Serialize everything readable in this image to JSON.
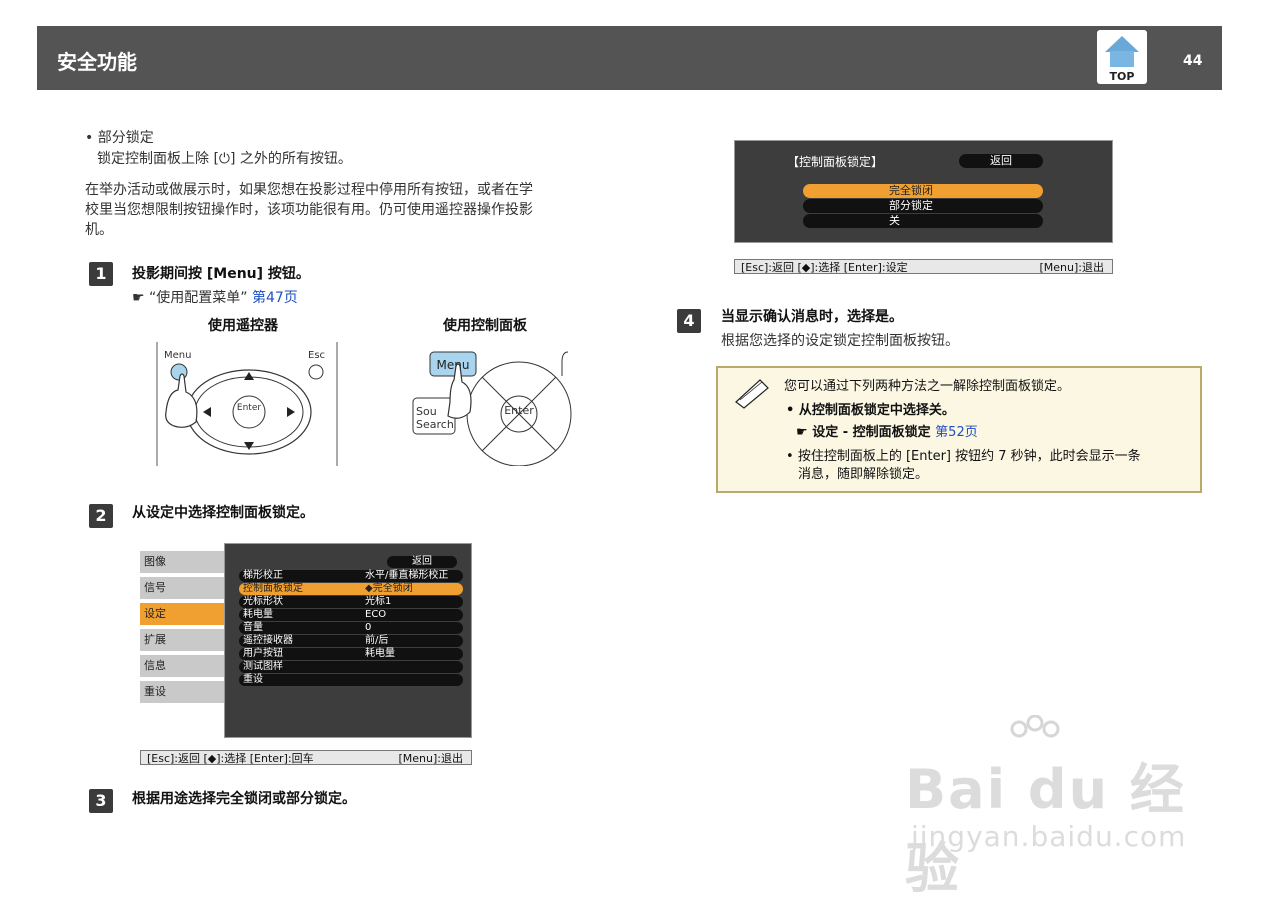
{
  "header": {
    "title": "安全功能",
    "top_label": "TOP",
    "page_number": "44"
  },
  "intro": {
    "bullet_title": "部分锁定",
    "bullet_desc": "锁定控制面板上除 [⏻] 之外的所有按钮。",
    "para_line1": "在举办活动或做展示时，如果您想在投影过程中停用所有按钮，或者在学",
    "para_line2": "校里当您想限制按钮操作时，该项功能很有用。仍可使用遥控器操作投影",
    "para_line3": "机。"
  },
  "steps": [
    {
      "num": "1",
      "text": "投影期间按 [Menu] 按钮。",
      "ref_text": "“使用配置菜单”",
      "ref_link": "第47页"
    },
    {
      "num": "2",
      "text": "从设定中选择控制面板锁定。"
    },
    {
      "num": "3",
      "text": "根据用途选择完全锁闭或部分锁定。"
    },
    {
      "num": "4",
      "text": "当显示确认消息时，选择是。",
      "desc": "根据您选择的设定锁定控制面板按钮。"
    }
  ],
  "illustrations": {
    "remote_caption": "使用遥控器",
    "panel_caption": "使用控制面板",
    "remote_menu": "Menu",
    "remote_esc": "Esc",
    "remote_enter": "Enter",
    "panel_menu": "Menu",
    "panel_source": "Sou",
    "panel_search": "Search",
    "panel_enter": "Enter"
  },
  "menu1": {
    "tabs": [
      "图像",
      "信号",
      "设定",
      "扩展",
      "信息",
      "重设"
    ],
    "back": "返回",
    "rows": [
      {
        "label": "梯形校正",
        "value": "水平/垂直梯形校正"
      },
      {
        "label": "控制面板锁定",
        "value": "◆完全锁闭"
      },
      {
        "label": "光标形状",
        "value": "光标1"
      },
      {
        "label": "耗电量",
        "value": "ECO"
      },
      {
        "label": "音量",
        "value": "0"
      },
      {
        "label": "遥控接收器",
        "value": "前/后"
      },
      {
        "label": "用户按钮",
        "value": "耗电量"
      },
      {
        "label": "测试图样",
        "value": ""
      },
      {
        "label": "重设",
        "value": ""
      }
    ],
    "footer_left": "[Esc]:返回 [◆]:选择 [Enter]:回车",
    "footer_right": "[Menu]:退出"
  },
  "menu2": {
    "label": "【控制面板锁定】",
    "back": "返回",
    "options": [
      "完全锁闭",
      "部分锁定",
      "关"
    ],
    "footer_left": "[Esc]:返回 [◆]:选择 [Enter]:设定",
    "footer_right": "[Menu]:退出"
  },
  "note": {
    "intro": "您可以通过下列两种方法之一解除控制面板锁定。",
    "item1": "从控制面板锁定中选择关。",
    "item1_ref_text": "设定 - 控制面板锁定",
    "item1_ref_link": "第52页",
    "item2_line1": "按住控制面板上的 [Enter] 按钮约 7 秒钟，此时会显示一条",
    "item2_line2": "消息，随即解除锁定。"
  },
  "watermark": {
    "brand": "Bai du 经验",
    "url": "jingyan.baidu.com"
  }
}
